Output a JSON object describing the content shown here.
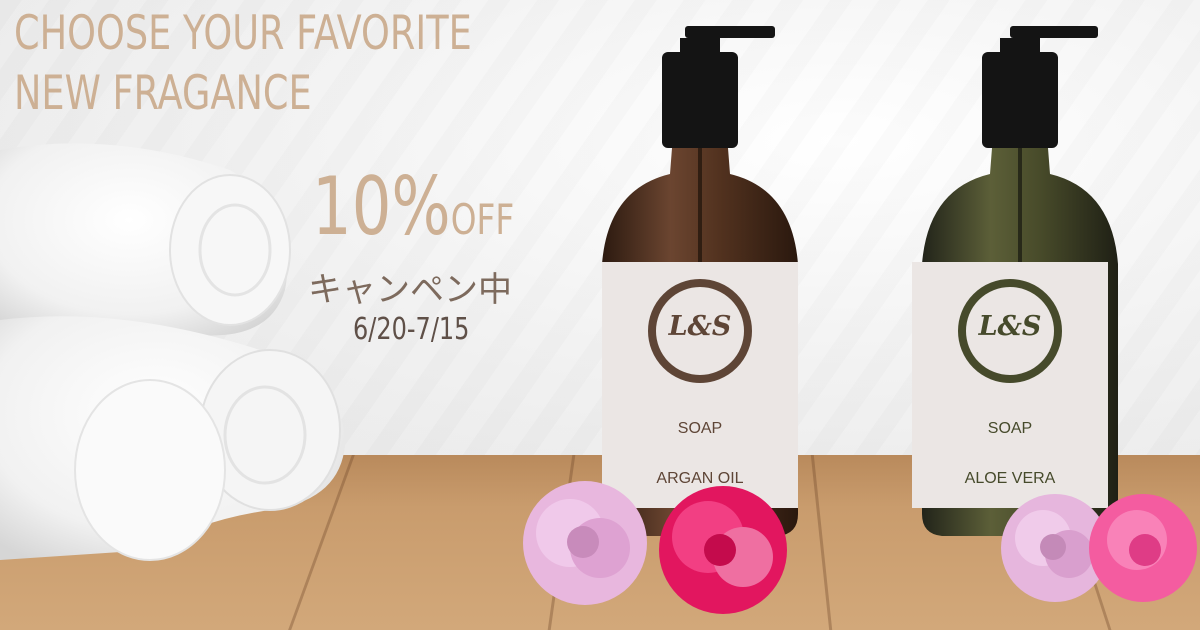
{
  "headline": {
    "line1": "CHOOSE YOUR FAVORITE",
    "line2": "NEW FRAGANCE"
  },
  "promo": {
    "discount_number": "10%",
    "discount_suffix": "OFF",
    "campaign": "キャンペン中",
    "dates": "6/20-7/15"
  },
  "products": [
    {
      "logo": "L&S",
      "type": "SOAP",
      "variant": "ARGAN OIL",
      "bottle_color": "#4a2c1c",
      "logo_color": "#5e4536"
    },
    {
      "logo": "L&S",
      "type": "SOAP",
      "variant": "ALOE VERA",
      "bottle_color": "#3c3f22",
      "logo_color": "#464a2b"
    }
  ],
  "colors": {
    "headline": "#cdb094",
    "label": "#ebe6e4",
    "cap": "#141414"
  }
}
